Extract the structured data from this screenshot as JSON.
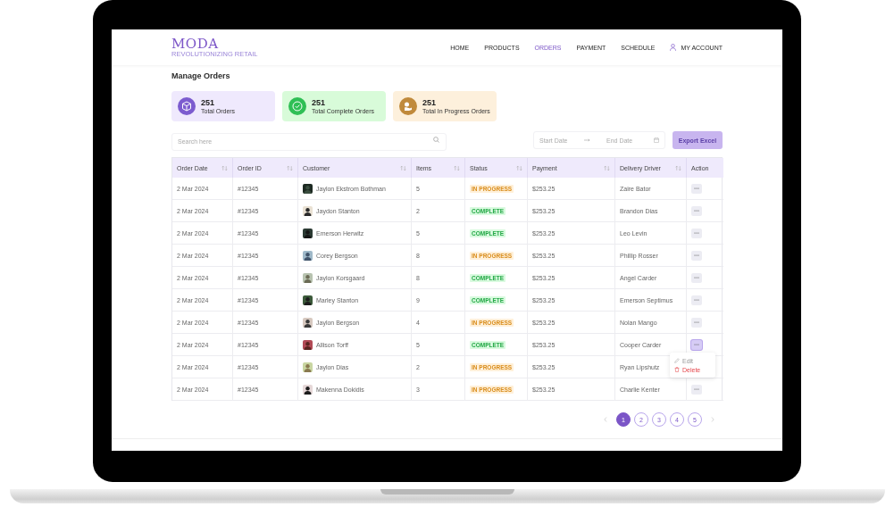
{
  "header": {
    "logo": "MODA",
    "tagline": "REVOLUTIONIZING RETAIL",
    "nav": [
      {
        "label": "HOME",
        "selected": false
      },
      {
        "label": "PRODUCTS",
        "selected": false
      },
      {
        "label": "ORDERS",
        "selected": true
      },
      {
        "label": "PAYMENT",
        "selected": false
      },
      {
        "label": "SCHEDULE",
        "selected": false
      }
    ],
    "account": "MY ACCOUNT"
  },
  "page_title": "Manage Orders",
  "stats": [
    {
      "kind": "orders",
      "value": "251",
      "label": "Total Orders"
    },
    {
      "kind": "complete",
      "value": "251",
      "label": "Total Complete Orders"
    },
    {
      "kind": "progress",
      "value": "251",
      "label": "Total In Progress Orders"
    }
  ],
  "search": {
    "placeholder": "Search here"
  },
  "date_range": {
    "start_placeholder": "Start Date",
    "end_placeholder": "End Date"
  },
  "export_button": "Export Excel",
  "table": {
    "columns": [
      {
        "label": "Order Date",
        "sortable": true
      },
      {
        "label": "Order ID",
        "sortable": true
      },
      {
        "label": "Customer",
        "sortable": true
      },
      {
        "label": "Items",
        "sortable": true
      },
      {
        "label": "Status",
        "sortable": true
      },
      {
        "label": "Payment",
        "sortable": true
      },
      {
        "label": "Delivery Driver",
        "sortable": true
      },
      {
        "label": "Action",
        "sortable": false
      }
    ],
    "rows": [
      {
        "date": "2 Mar 2024",
        "order_id": "#12345",
        "customer": "Jaylon Ekstrom Bothman",
        "items": "5",
        "status": {
          "label": "IN PROGRESS",
          "kind": "progress"
        },
        "payment": "$253.25",
        "driver": "Zaire Bator",
        "menu_open": false
      },
      {
        "date": "2 Mar 2024",
        "order_id": "#12345",
        "customer": "Jaydon Stanton",
        "items": "2",
        "status": {
          "label": "COMPLETE",
          "kind": "complete"
        },
        "payment": "$253.25",
        "driver": "Brandon Dias",
        "menu_open": false
      },
      {
        "date": "2 Mar 2024",
        "order_id": "#12345",
        "customer": "Emerson Herwitz",
        "items": "5",
        "status": {
          "label": "COMPLETE",
          "kind": "complete"
        },
        "payment": "$253.25",
        "driver": "Leo Levin",
        "menu_open": false
      },
      {
        "date": "2 Mar 2024",
        "order_id": "#12345",
        "customer": "Corey Bergson",
        "items": "8",
        "status": {
          "label": "IN PROGRESS",
          "kind": "progress"
        },
        "payment": "$253.25",
        "driver": "Phillip Rosser",
        "menu_open": false
      },
      {
        "date": "2 Mar 2024",
        "order_id": "#12345",
        "customer": "Jaylon Korsgaard",
        "items": "8",
        "status": {
          "label": "COMPLETE",
          "kind": "complete"
        },
        "payment": "$253.25",
        "driver": "Angel Carder",
        "menu_open": false
      },
      {
        "date": "2 Mar 2024",
        "order_id": "#12345",
        "customer": "Marley Stanton",
        "items": "9",
        "status": {
          "label": "COMPLETE",
          "kind": "complete"
        },
        "payment": "$253.25",
        "driver": "Emerson Septimus",
        "menu_open": false
      },
      {
        "date": "2 Mar 2024",
        "order_id": "#12345",
        "customer": "Jaylon Bergson",
        "items": "4",
        "status": {
          "label": "IN PROGRESS",
          "kind": "progress"
        },
        "payment": "$253.25",
        "driver": "Nolan Mango",
        "menu_open": false
      },
      {
        "date": "2 Mar 2024",
        "order_id": "#12345",
        "customer": "Allison Torff",
        "items": "5",
        "status": {
          "label": "COMPLETE",
          "kind": "complete"
        },
        "payment": "$253.25",
        "driver": "Cooper Carder",
        "menu_open": true
      },
      {
        "date": "2 Mar 2024",
        "order_id": "#12345",
        "customer": "Jaylon Dias",
        "items": "2",
        "status": {
          "label": "IN PROGRESS",
          "kind": "progress"
        },
        "payment": "$253.25",
        "driver": "Ryan Lipshutz",
        "menu_open": false
      },
      {
        "date": "2 Mar 2024",
        "order_id": "#12345",
        "customer": "Makenna Dokidis",
        "items": "3",
        "status": {
          "label": "IN PROGRESS",
          "kind": "progress"
        },
        "payment": "$253.25",
        "driver": "Charlie Kenter",
        "menu_open": false
      }
    ]
  },
  "row_menu": [
    {
      "kind": "edit",
      "label": "Edit"
    },
    {
      "kind": "delete",
      "label": "Delete"
    }
  ],
  "pagination": {
    "pages": [
      {
        "label": "1",
        "selected": true
      },
      {
        "label": "2",
        "selected": false
      },
      {
        "label": "3",
        "selected": false
      },
      {
        "label": "4",
        "selected": false
      },
      {
        "label": "5",
        "selected": false
      }
    ]
  }
}
